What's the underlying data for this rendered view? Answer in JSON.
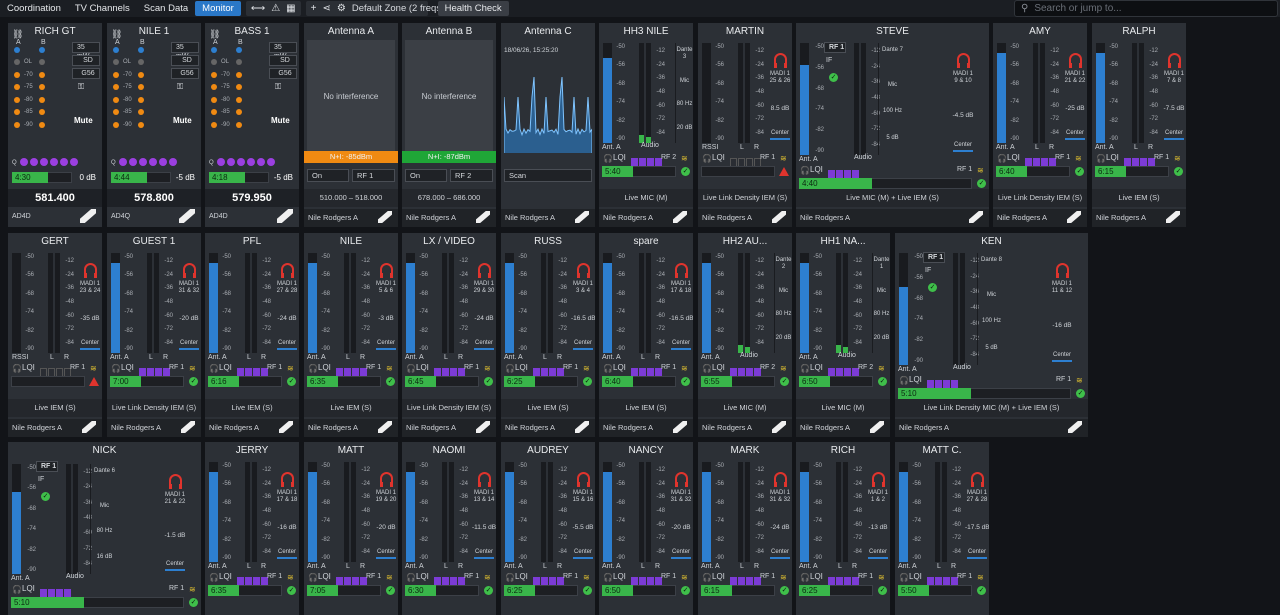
{
  "toolbar": {
    "tabs": [
      {
        "label": "Coordination",
        "active": false
      },
      {
        "label": "TV Channels",
        "active": false
      },
      {
        "label": "Scan Data",
        "active": false
      },
      {
        "label": "Monitor",
        "active": true
      }
    ],
    "zone_label": "Default Zone (2 freqs)",
    "health_check": "Health Check",
    "search_placeholder": "Search or jump to..."
  },
  "colors": {
    "accent": "#2a78c8",
    "ok": "#39b54a",
    "lqi": "#7c3bd6",
    "alarm": "#e0342d",
    "meter": "#2d7fd0"
  },
  "rf_panels": [
    {
      "name": "RICH GT",
      "power": "35 mW",
      "mode": "SD",
      "group": "G56",
      "mute": "Mute",
      "time": "4:30",
      "gain": "0 dB",
      "freq": "581.400",
      "model": "AD4D",
      "ant_labels": [
        "A",
        "B"
      ],
      "scale": [
        "OL",
        "-70",
        "-75",
        "-80",
        "-85",
        "-90"
      ]
    },
    {
      "name": "NILE 1",
      "power": "35 mW",
      "mode": "SD",
      "group": "G56",
      "mute": "Mute",
      "time": "4:44",
      "gain": "-5 dB",
      "freq": "578.800",
      "model": "AD4Q",
      "ant_labels": [
        "A",
        "B"
      ],
      "scale": [
        "OL",
        "-70",
        "-75",
        "-80",
        "-85",
        "-90"
      ]
    },
    {
      "name": "BASS 1",
      "power": "35 mW",
      "mode": "SD",
      "group": "G56",
      "mute": "Mute",
      "time": "4:18",
      "gain": "-5 dB",
      "freq": "579.950",
      "model": "AD4D",
      "ant_labels": [
        "A",
        "B"
      ],
      "scale": [
        "OL",
        "-70",
        "-75",
        "-80",
        "-85",
        "-90"
      ]
    }
  ],
  "antenna_panels": [
    {
      "name": "Antenna A",
      "status": "No interference",
      "noise": "N+I: -85dBm",
      "noise_color": "#f08a12",
      "state": "On",
      "rf": "RF 1",
      "range": "510.000 – 518.000",
      "owner": "Nile Rodgers A"
    },
    {
      "name": "Antenna B",
      "status": "No interference",
      "noise": "N+I: -87dBm",
      "noise_color": "#1fa637",
      "state": "On",
      "rf": "RF 2",
      "range": "678.000 – 686.000",
      "owner": "Nile Rodgers A"
    }
  ],
  "scan_panel": {
    "name": "Antenna C",
    "timestamp": "18/06/26, 15:25:20",
    "button": "Scan",
    "owner": "Nile Rodgers A"
  },
  "channels": [
    {
      "name": "HH3 NILE",
      "kind": "mic",
      "dante": "Dante 3",
      "hz": "80 Hz",
      "db": "20 dB",
      "time": "5:40",
      "rf": "RF 2",
      "type": "Live MIC (M)",
      "owner": "Nile Rodgers A",
      "ok": true,
      "fill": 0.85
    },
    {
      "name": "MARTIN",
      "kind": "iem",
      "madi": "MADI 1 25 & 26",
      "db": "8.5 dB",
      "pan": "Center",
      "time": "",
      "rf": "RF 1",
      "type": "Live Link Density IEM (S)",
      "owner": "Nile Rodgers A",
      "ok": false,
      "fill": 0,
      "rssi": true
    },
    {
      "name": "STEVE",
      "kind": "combo",
      "dante": "Dante 7",
      "madi": "MADI 1 9 & 10",
      "hz": "100 Hz",
      "db": "5 dB",
      "db2": "-4.5 dB",
      "pan": "Center",
      "time": "4:40",
      "rf": "RF 1",
      "type": "Live MIC (M) + Live IEM (S)",
      "owner": "Nile Rodgers A",
      "ok": true,
      "fill": 0.8
    },
    {
      "name": "AMY",
      "kind": "iem",
      "madi": "MADI 1 21 & 22",
      "db": "-25 dB",
      "pan": "Center",
      "time": "6:40",
      "rf": "RF 1",
      "type": "Live Link Density IEM (S)",
      "owner": "Nile Rodgers A",
      "ok": true,
      "fill": 0.9
    },
    {
      "name": "RALPH",
      "kind": "iem",
      "madi": "MADI 1 7 & 8",
      "db": "-7.5 dB",
      "pan": "Center",
      "time": "6:15",
      "rf": "RF 1",
      "type": "Live IEM (S)",
      "owner": "Nile Rodgers A",
      "ok": true,
      "fill": 0.9
    },
    {
      "name": "GERT",
      "kind": "iem",
      "madi": "MADI 1 23 & 24",
      "db": "-35 dB",
      "pan": "Center",
      "time": "",
      "rf": "RF 1",
      "type": "Live IEM (S)",
      "owner": "Nile Rodgers A",
      "ok": false,
      "fill": 0,
      "rssi": true
    },
    {
      "name": "GUEST 1",
      "kind": "iem",
      "madi": "MADI 1 31 & 32",
      "db": "-20 dB",
      "pan": "Center",
      "time": "7:00",
      "rf": "RF 1",
      "type": "Live Link Density IEM (S)",
      "owner": "Nile Rodgers A",
      "ok": true,
      "fill": 0.9
    },
    {
      "name": "PFL",
      "kind": "iem",
      "madi": "MADI 1 27 & 28",
      "db": "-24 dB",
      "pan": "Center",
      "time": "6:16",
      "rf": "RF 1",
      "type": "Live IEM (S)",
      "owner": "Nile Rodgers A",
      "ok": true,
      "fill": 0.9
    },
    {
      "name": "NILE",
      "kind": "iem",
      "madi": "MADI 1 5 & 6",
      "db": "-3 dB",
      "pan": "Center",
      "time": "6:35",
      "rf": "RF 1",
      "type": "Live IEM (S)",
      "owner": "Nile Rodgers A",
      "ok": true,
      "fill": 0.9
    },
    {
      "name": "LX / VIDEO",
      "kind": "iem",
      "madi": "MADI 1 29 & 30",
      "db": "-24 dB",
      "pan": "Center",
      "time": "6:45",
      "rf": "RF 1",
      "type": "Live Link Density IEM (S)",
      "owner": "Nile Rodgers A",
      "ok": true,
      "fill": 0.9
    },
    {
      "name": "RUSS",
      "kind": "iem",
      "madi": "MADI 1 3 & 4",
      "db": "-16.5 dB",
      "pan": "Center",
      "time": "6:25",
      "rf": "RF 1",
      "type": "Live IEM (S)",
      "owner": "Nile Rodgers A",
      "ok": true,
      "fill": 0.9
    },
    {
      "name": "spare",
      "kind": "iem",
      "madi": "MADI 1 17 & 18",
      "db": "-16.5 dB",
      "pan": "Center",
      "time": "6:40",
      "rf": "RF 1",
      "type": "Live IEM (S)",
      "owner": "Nile Rodgers A",
      "ok": true,
      "fill": 0.9
    },
    {
      "name": "HH2 AU...",
      "kind": "mic",
      "dante": "Dante 2",
      "hz": "80 Hz",
      "db": "20 dB",
      "time": "6:55",
      "rf": "RF 2",
      "type": "Live MIC (M)",
      "owner": "Nile Rodgers A",
      "ok": true,
      "fill": 0.9
    },
    {
      "name": "HH1 NA...",
      "kind": "mic",
      "dante": "Dante 1",
      "hz": "80 Hz",
      "db": "20 dB",
      "time": "6:50",
      "rf": "RF 2",
      "type": "Live MIC (M)",
      "owner": "Nile Rodgers A",
      "ok": true,
      "fill": 0.9
    },
    {
      "name": "KEN",
      "kind": "combo",
      "dante": "Dante 8",
      "madi": "MADI 1 11 & 12",
      "hz": "100 Hz",
      "db": "5 dB",
      "db2": "-16 dB",
      "pan": "Center",
      "time": "5:10",
      "rf": "RF 1",
      "type": "Live Link Density MIC (M) + Live IEM (S)",
      "owner": "Nile Rodgers A",
      "ok": true,
      "fill": 0.7
    },
    {
      "name": "NICK",
      "kind": "combo",
      "dante": "Dante 6",
      "madi": "MADI 1 21 & 22",
      "hz": "80 Hz",
      "db": "16 dB",
      "db2": "-1.5 dB",
      "pan": "Center",
      "time": "5:10",
      "rf": "RF 1",
      "type": "",
      "owner": "",
      "ok": true,
      "fill": 0.75
    },
    {
      "name": "JERRY",
      "kind": "iem",
      "madi": "MADI 1 17 & 18",
      "db": "-16 dB",
      "pan": "Center",
      "time": "6:35",
      "rf": "RF 1",
      "type": "",
      "owner": "",
      "ok": true,
      "fill": 0.9
    },
    {
      "name": "MATT",
      "kind": "iem",
      "madi": "MADI 1 19 & 20",
      "db": "-20 dB",
      "pan": "Center",
      "time": "7:05",
      "rf": "RF 1",
      "type": "",
      "owner": "",
      "ok": true,
      "fill": 0.9
    },
    {
      "name": "NAOMI",
      "kind": "iem",
      "madi": "MADI 1 13 & 14",
      "db": "-11.5 dB",
      "pan": "Center",
      "time": "6:30",
      "rf": "RF 1",
      "type": "",
      "owner": "",
      "ok": true,
      "fill": 0.9
    },
    {
      "name": "AUDREY",
      "kind": "iem",
      "madi": "MADI 1 15 & 16",
      "db": "-5.5 dB",
      "pan": "Center",
      "time": "6:25",
      "rf": "RF 1",
      "type": "",
      "owner": "",
      "ok": true,
      "fill": 0.9
    },
    {
      "name": "NANCY",
      "kind": "iem",
      "madi": "MADI 1 31 & 32",
      "db": "-20 dB",
      "pan": "Center",
      "time": "6:50",
      "rf": "RF 1",
      "type": "",
      "owner": "",
      "ok": true,
      "fill": 0.9
    },
    {
      "name": "MARK",
      "kind": "iem",
      "madi": "MADI 1 31 & 32",
      "db": "-24 dB",
      "pan": "Center",
      "time": "6:15",
      "rf": "RF 1",
      "type": "",
      "owner": "",
      "ok": true,
      "fill": 0.9
    },
    {
      "name": "RICH",
      "kind": "iem",
      "madi": "MADI 1 1 & 2",
      "db": "-13 dB",
      "pan": "Center",
      "time": "6:25",
      "rf": "RF 1",
      "type": "",
      "owner": "",
      "ok": true,
      "fill": 0.9
    },
    {
      "name": "MATT C.",
      "kind": "iem",
      "madi": "MADI 1 27 & 28",
      "db": "-17.5 dB",
      "pan": "Center",
      "time": "5:50",
      "rf": "RF 1",
      "type": "",
      "owner": "",
      "ok": true,
      "fill": 0.9
    }
  ],
  "labels": {
    "ant_a": "Ant. A",
    "ant_b": "Ant. B",
    "l": "L",
    "r": "R",
    "lqi": "LQI",
    "audio": "Audio",
    "mic": "Mic",
    "rssi": "RSSI",
    "rf1": "RF 1",
    "if": "IF",
    "q": "Q"
  },
  "iem_scale": [
    "-50",
    "-56",
    "-68",
    "-74",
    "-82",
    "-90"
  ],
  "aud_scale": [
    "-12",
    "-24",
    "-36",
    "-48",
    "-60",
    "-72",
    "-84"
  ]
}
